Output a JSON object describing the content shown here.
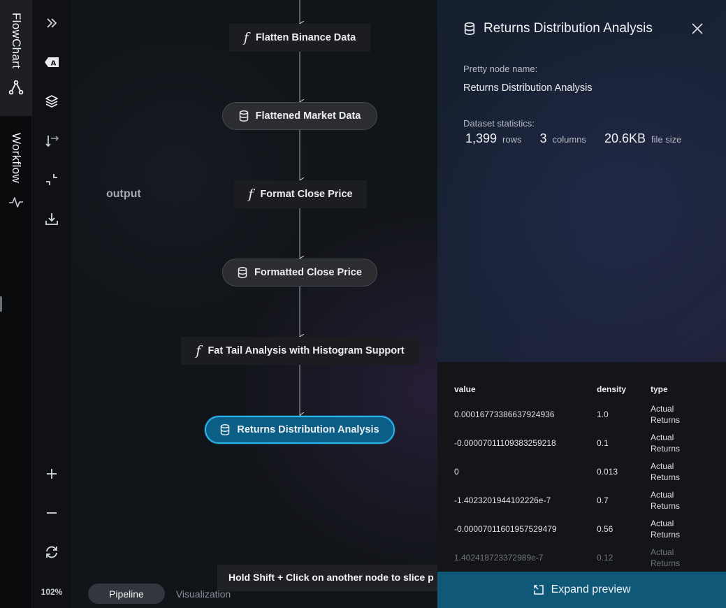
{
  "rail": {
    "flowchart_label": "FlowChart",
    "workflow_label": "Workflow"
  },
  "tools": {
    "zoom_level": "102%"
  },
  "canvas": {
    "output_label": "output",
    "nodes": [
      {
        "kind": "function",
        "label": "Flatten Binance Data"
      },
      {
        "kind": "dataset",
        "label": "Flattened Market Data"
      },
      {
        "kind": "function",
        "label": "Format Close Price"
      },
      {
        "kind": "dataset",
        "label": "Formatted Close Price"
      },
      {
        "kind": "function",
        "label": "Fat Tail Analysis with Histogram Support"
      },
      {
        "kind": "dataset",
        "label": "Returns Distribution Analysis",
        "selected": true
      }
    ],
    "function_glyph": "f",
    "hint": "Hold Shift + Click on another node to slice p",
    "view_toggle": {
      "pipeline": "Pipeline",
      "visualization": "Visualization",
      "active": "Pipeline"
    }
  },
  "panel": {
    "title": "Returns Distribution Analysis",
    "pretty_name_label": "Pretty node name:",
    "pretty_name_value": "Returns Distribution Analysis",
    "stats_label": "Dataset statistics:",
    "stats": {
      "rows": "1,399",
      "rows_unit": "rows",
      "columns": "3",
      "columns_unit": "columns",
      "size": "20.6KB",
      "size_unit": "file size"
    },
    "preview": {
      "headers": [
        "value",
        "density",
        "type"
      ],
      "rows": [
        [
          "0.00016773386637924936",
          "1.0",
          "Actual Returns"
        ],
        [
          "-0.00007011109383259218",
          "0.1",
          "Actual Returns"
        ],
        [
          "0",
          "0.013",
          "Actual Returns"
        ],
        [
          "-1.4023201944102226e-7",
          "0.7",
          "Actual Returns"
        ],
        [
          "-0.00007011601957529479",
          "0.56",
          "Actual Returns"
        ],
        [
          "1.402418723372989e-7",
          "0.12",
          "Actual Returns"
        ]
      ]
    },
    "expand_label": "Expand preview"
  },
  "colors": {
    "selected_node": "#0b5f86",
    "selected_border": "#2bb5ec",
    "expand_bar": "#0f5878"
  }
}
